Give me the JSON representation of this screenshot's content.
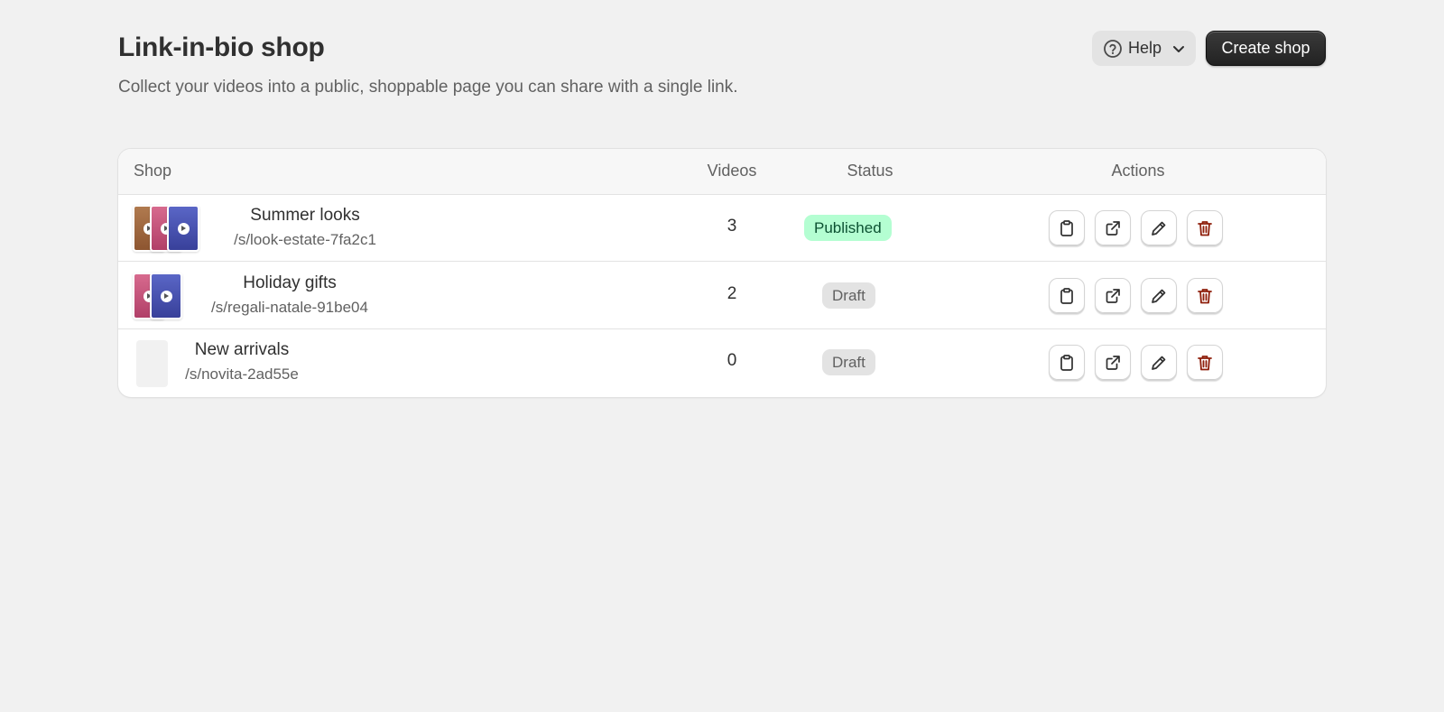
{
  "header": {
    "title": "Link-in-bio shop",
    "subtitle": "Collect your videos into a public, shoppable page you can share with a single link.",
    "help_label": "Help",
    "create_label": "Create shop"
  },
  "table": {
    "columns": {
      "shop": "Shop",
      "videos": "Videos",
      "status": "Status",
      "actions": "Actions"
    },
    "rows": [
      {
        "name": "Summer looks",
        "path": "/s/look-estate-7fa2c1",
        "videos": "3",
        "status": "Published"
      },
      {
        "name": "Holiday gifts",
        "path": "/s/regali-natale-91be04",
        "videos": "2",
        "status": "Draft"
      },
      {
        "name": "New arrivals",
        "path": "/s/novita-2ad55e",
        "videos": "0",
        "status": "Draft"
      }
    ]
  },
  "icons": {
    "help": "question-circle-icon",
    "chevron": "chevron-down-icon",
    "copy": "clipboard-icon",
    "open": "external-link-icon",
    "edit": "pencil-icon",
    "delete": "trash-icon"
  },
  "colors": {
    "background": "#f1f1f1",
    "primary_button": "#303030",
    "published_badge": "#b4fed2",
    "draft_badge": "#e3e3e3",
    "delete_icon": "#8e1f0b",
    "thumb_brown": "#a0673f",
    "thumb_pink": "#c9507a",
    "thumb_blue": "#4a54b0"
  }
}
